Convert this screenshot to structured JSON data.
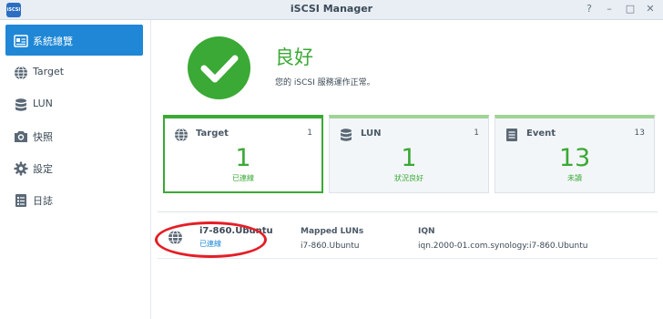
{
  "window": {
    "title": "iSCSI Manager",
    "app_icon_text": "iSCSI",
    "help": "?",
    "minimize": "–",
    "maximize": "□",
    "close": "✕"
  },
  "sidebar": {
    "items": [
      {
        "label": "系統總覽",
        "icon": "overview-icon",
        "active": true
      },
      {
        "label": "Target",
        "icon": "globe-icon"
      },
      {
        "label": "LUN",
        "icon": "database-icon"
      },
      {
        "label": "快照",
        "icon": "camera-icon"
      },
      {
        "label": "設定",
        "icon": "gear-icon"
      },
      {
        "label": "日誌",
        "icon": "log-icon"
      }
    ]
  },
  "status": {
    "title": "良好",
    "description": "您的 iSCSI 服務運作正常。",
    "color": "#3aa935"
  },
  "cards": [
    {
      "name": "Target",
      "count": "1",
      "big": "1",
      "sub": "已連線",
      "icon": "globe-icon"
    },
    {
      "name": "LUN",
      "count": "1",
      "big": "1",
      "sub": "狀況良好",
      "icon": "database-icon"
    },
    {
      "name": "Event",
      "count": "13",
      "big": "13",
      "sub": "未讀",
      "icon": "document-icon"
    }
  ],
  "target_row": {
    "name": "i7-860.Ubuntu",
    "status": "已連線",
    "mapped_luns_header": "Mapped LUNs",
    "mapped_luns_value": "i7-860.Ubuntu",
    "iqn_header": "IQN",
    "iqn_value": "iqn.2000-01.com.synology:i7-860.Ubuntu"
  },
  "colors": {
    "accent": "#1f87d6",
    "success": "#3aa935",
    "annotation": "#e41e26"
  }
}
